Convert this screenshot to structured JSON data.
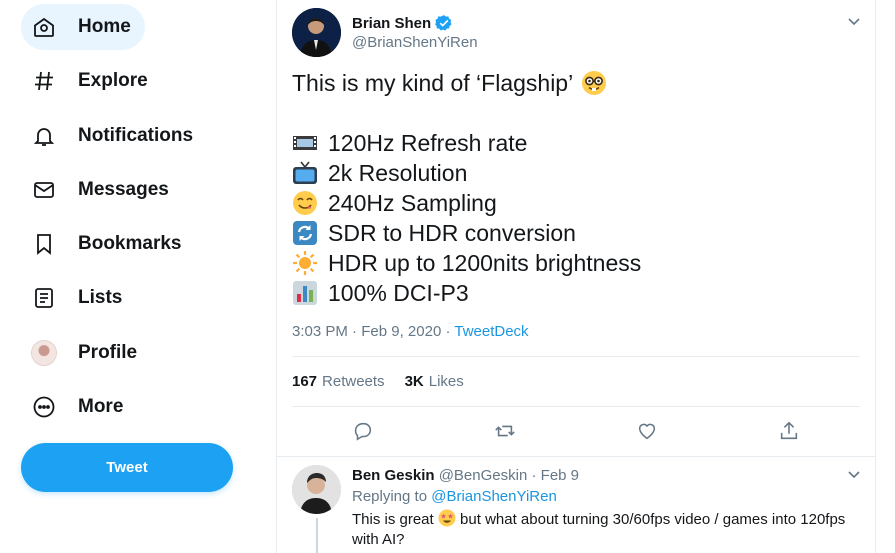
{
  "sidebar": {
    "items": [
      {
        "label": "Home",
        "icon": "home-icon",
        "active": true
      },
      {
        "label": "Explore",
        "icon": "hashtag-icon"
      },
      {
        "label": "Notifications",
        "icon": "bell-icon"
      },
      {
        "label": "Messages",
        "icon": "envelope-icon"
      },
      {
        "label": "Bookmarks",
        "icon": "bookmark-icon"
      },
      {
        "label": "Lists",
        "icon": "list-icon"
      },
      {
        "label": "Profile",
        "icon": "avatar"
      },
      {
        "label": "More",
        "icon": "more-circle-icon"
      }
    ],
    "tweet_button": "Tweet"
  },
  "tweet": {
    "author_name": "Brian Shen",
    "author_handle": "@BrianShenYiRen",
    "verified": true,
    "headline": "This is my kind of ‘Flagship’",
    "lines": [
      {
        "emoji": "film-frames",
        "text": "120Hz Refresh rate"
      },
      {
        "emoji": "television",
        "text": "2k Resolution"
      },
      {
        "emoji": "face-savoring-food",
        "text": "240Hz Sampling"
      },
      {
        "emoji": "repeat-arrows",
        "text": "SDR to HDR conversion"
      },
      {
        "emoji": "sun",
        "text": "HDR up to 1200nits brightness"
      },
      {
        "emoji": "bar-chart",
        "text": "100% DCI-P3"
      }
    ],
    "time": "3:03 PM",
    "date": "Feb 9, 2020",
    "source": "TweetDeck",
    "retweets_count": "167",
    "retweets_label": "Retweets",
    "likes_count": "3K",
    "likes_label": "Likes",
    "actions": [
      "reply-icon",
      "retweet-icon",
      "like-icon",
      "share-icon"
    ]
  },
  "reply": {
    "author_name": "Ben Geskin",
    "author_handle": "@BenGeskin",
    "date": "Feb 9",
    "replying_prefix": "Replying to",
    "replying_to": "@BrianShenYiRen",
    "text_before": "This is great",
    "text_after": "but what about turning 30/60fps video / games into 120fps with AI?"
  },
  "colors": {
    "accent": "#1da1f2",
    "link": "#1b95e0",
    "muted": "#657786",
    "active_nav_bg": "#e8f5fe"
  }
}
